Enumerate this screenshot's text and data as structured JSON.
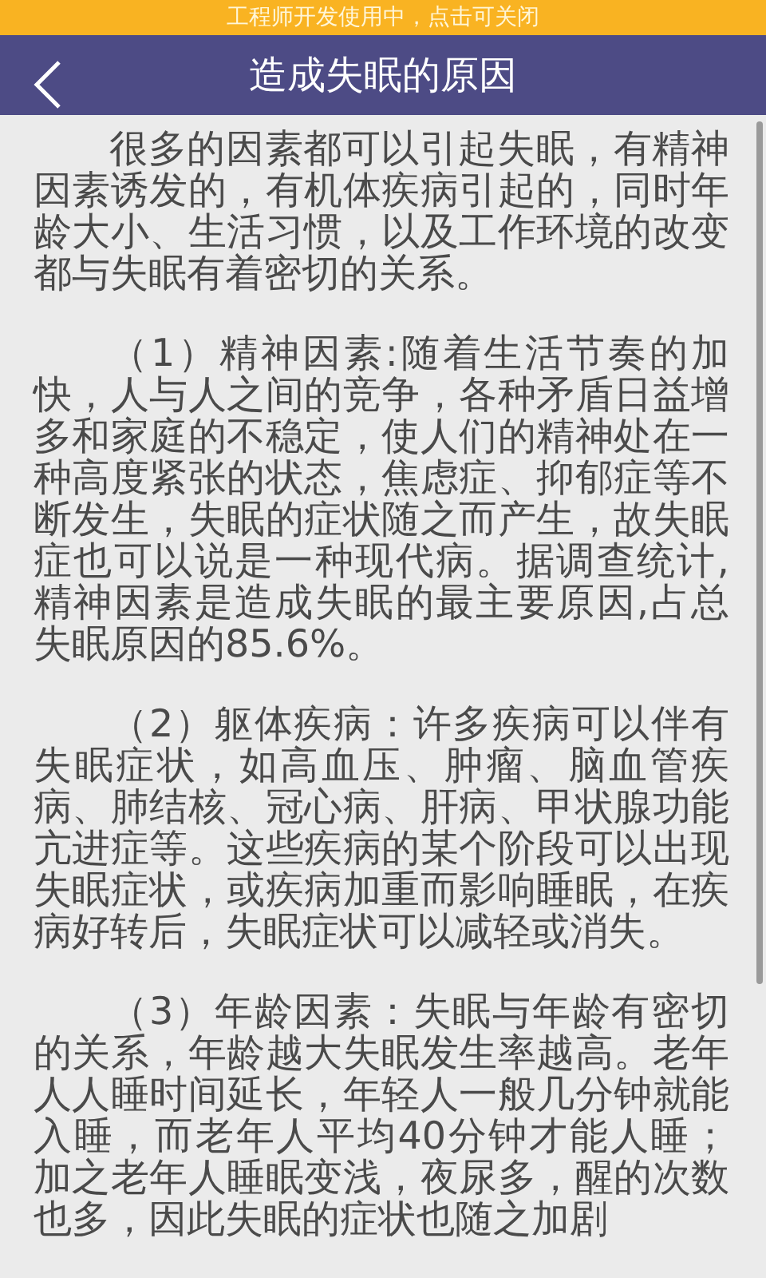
{
  "dev_banner": {
    "text": "工程师开发使用中，点击可关闭"
  },
  "header": {
    "title": "造成失眠的原因"
  },
  "article": {
    "paragraphs": [
      "很多的因素都可以引起失眠，有精神因素诱发的，有机体疾病引起的，同时年龄大小、生活习惯，以及工作环境的改变都与失眠有着密切的关系。",
      "（1）精神因素:随着生活节奏的加快，人与人之间的竞争，各种矛盾日益增多和家庭的不稳定，使人们的精神处在一种高度紧张的状态，焦虑症、抑郁症等不断发生，失眠的症状随之而产生，故失眠症也可以说是一种现代病。据调查统计,精神因素是造成失眠的最主要原因,占总失眠原因的85.6%。",
      "（2）躯体疾病：许多疾病可以伴有失眠症状，如高血压、肿瘤、脑血管疾病、肺结核、冠心病、肝病、甲状腺功能亢进症等。这些疾病的某个阶段可以出现失眠症状，或疾病加重而影响睡眠，在疾病好转后，失眠症状可以减轻或消失。",
      "（3）年龄因素：失眠与年龄有密切的关系，年龄越大失眠发生率越高。老年人人睡时间延长，年轻人一般几分钟就能入睡，而老年人平均40分钟才能人睡；加之老年人睡眠变浅，夜尿多，醒的次数也多，因此失眠的症状也随之加剧"
    ]
  }
}
